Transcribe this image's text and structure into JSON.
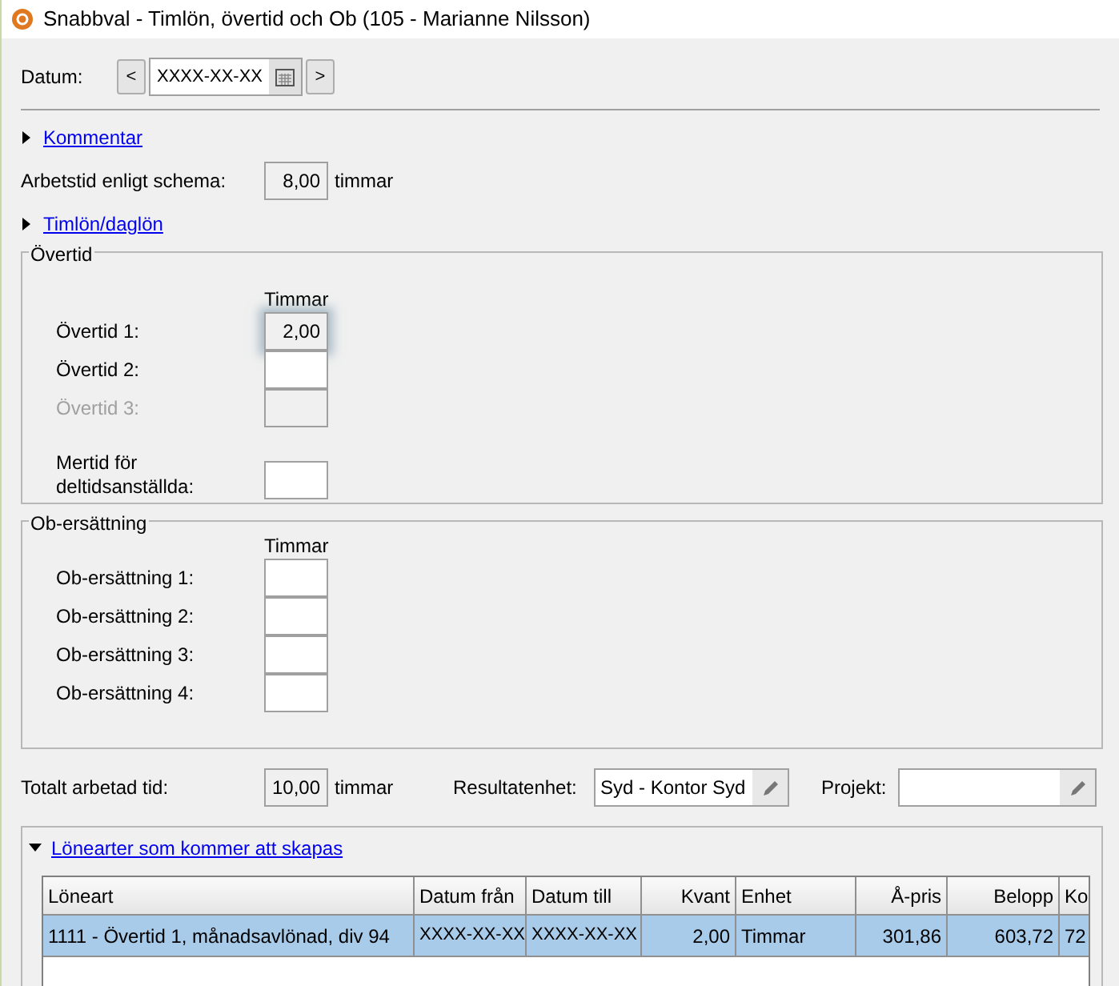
{
  "window": {
    "title": "Snabbval - Timlön, övertid och Ob (105 - Marianne Nilsson)"
  },
  "datum": {
    "label": "Datum:",
    "prev": "<",
    "value": "XXXX-XX-XX",
    "next": ">"
  },
  "comment": {
    "title": "Kommentar",
    "expanded": false
  },
  "schedule": {
    "label": "Arbetstid enligt schema:",
    "value": "8,00",
    "unit": "timmar"
  },
  "hourly": {
    "title": "Timlön/daglön",
    "expanded": false
  },
  "overtime": {
    "title": "Övertid",
    "column": "Timmar",
    "rows": [
      {
        "label": "Övertid 1:",
        "value": "2,00",
        "disabled": false,
        "highlighted": true
      },
      {
        "label": "Övertid 2:",
        "disabled": false,
        "highlighted": false
      },
      {
        "label": "Övertid 3:",
        "disabled": true,
        "highlighted": false
      }
    ],
    "extra": {
      "label": "Mertid för deltidsanställda:"
    }
  },
  "ob": {
    "title": "Ob-ersättning",
    "column": "Timmar",
    "rows": [
      {
        "label": "Ob-ersättning 1:"
      },
      {
        "label": "Ob-ersättning 2:"
      },
      {
        "label": "Ob-ersättning 3:"
      },
      {
        "label": "Ob-ersättning 4:"
      }
    ]
  },
  "total": {
    "label": "Totalt arbetad tid:",
    "value": "10,00",
    "unit": "timmar"
  },
  "result_unit": {
    "label": "Resultatenhet:",
    "value": "Syd - Kontor Syd"
  },
  "project": {
    "label": "Projekt:"
  },
  "wage_types": {
    "title": "Lönearter som kommer att skapas",
    "expanded": true,
    "columns": [
      {
        "label": "Löneart",
        "kind": "text"
      },
      {
        "label": "Datum från",
        "kind": "text"
      },
      {
        "label": "Datum till",
        "kind": "text"
      },
      {
        "label": "Kvant",
        "kind": "number"
      },
      {
        "label": "Enhet",
        "kind": "text"
      },
      {
        "label": "Å-pris",
        "kind": "number"
      },
      {
        "label": "Belopp",
        "kind": "number"
      },
      {
        "label": "Ko",
        "kind": "text"
      }
    ],
    "rows": [
      {
        "selected": true,
        "cells": [
          "1111 - Övertid 1, månadsavlönad, div 94",
          "XXXX-XX-XX",
          "XXXX-XX-XX",
          "2,00",
          "Timmar",
          "301,86",
          "603,72",
          "72"
        ]
      }
    ]
  }
}
